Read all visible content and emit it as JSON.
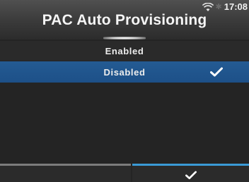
{
  "status": {
    "time": "17:08",
    "icons": [
      "wifi-icon",
      "bluetooth-icon"
    ]
  },
  "header": {
    "title": "PAC Auto Provisioning"
  },
  "list": {
    "items": [
      {
        "label": "Enabled",
        "selected": false
      },
      {
        "label": "Disabled",
        "selected": true,
        "icon": "check-icon"
      }
    ]
  },
  "bottom_bar": {
    "left_button": {
      "icon": "none"
    },
    "right_button": {
      "icon": "check-icon"
    }
  },
  "colors": {
    "selection": "#1d5088",
    "accent": "#3a9ad6",
    "background": "#242424"
  }
}
